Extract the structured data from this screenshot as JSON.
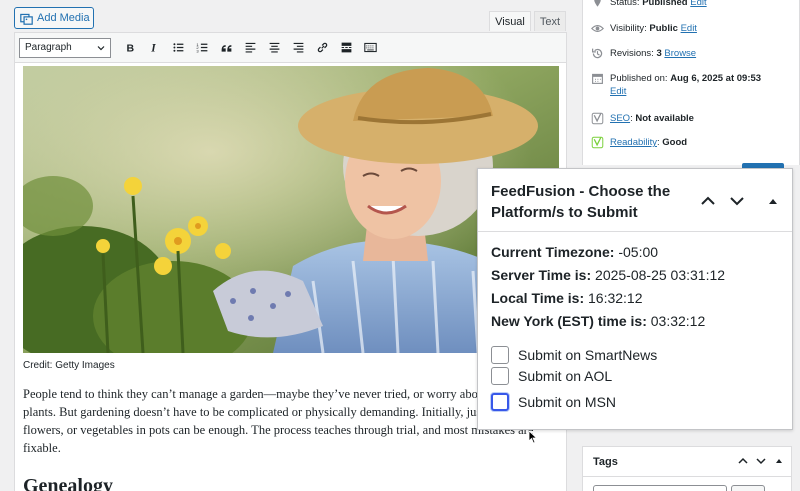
{
  "editor": {
    "add_media_label": "Add Media",
    "tabs": {
      "visual": "Visual",
      "text": "Text"
    },
    "format_select": "Paragraph",
    "image_caption": "Credit: Getty Images",
    "paragraph": "People tend to think they can’t manage a garden—maybe they’ve never tried, or worry about killing plants. But gardening doesn’t have to be complicated or physically demanding. Initially, just a few herbs, flowers, or vegetables in pots can be enough. The process teaches through trial, and most mistakes are fixable.",
    "heading": "Genealogy"
  },
  "sidebar": {
    "status": {
      "label": "Status:",
      "value": "Published",
      "link": "Edit"
    },
    "visibility": {
      "label": "Visibility:",
      "value": "Public",
      "link": "Edit"
    },
    "revisions": {
      "label": "Revisions:",
      "value": "3",
      "link": "Browse"
    },
    "published": {
      "label": "Published on:",
      "value": "Aug 6, 2025 at 09:53",
      "link": "Edit"
    },
    "seo": {
      "link": "SEO",
      "value": "Not available"
    },
    "readability": {
      "link": "Readability",
      "value": "Good"
    }
  },
  "popup": {
    "title": "FeedFusion - Choose the Platform/s to Submit",
    "timezone": {
      "label": "Current Timezone:",
      "value": "-05:00"
    },
    "server_time": {
      "label": "Server Time is:",
      "value": "2025-08-25 03:31:12"
    },
    "local_time": {
      "label": "Local Time is:",
      "value": "16:32:12"
    },
    "ny_time": {
      "label": "New York (EST) time is:",
      "value": "03:32:12"
    },
    "options": [
      {
        "label": "Submit on SmartNews",
        "checked": false
      },
      {
        "label": "Submit on AOL",
        "checked": false
      },
      {
        "label": "Submit on MSN",
        "checked": false
      }
    ]
  },
  "tags": {
    "title": "Tags"
  },
  "colors": {
    "accent": "#2271b1",
    "focus": "#3858e9"
  }
}
